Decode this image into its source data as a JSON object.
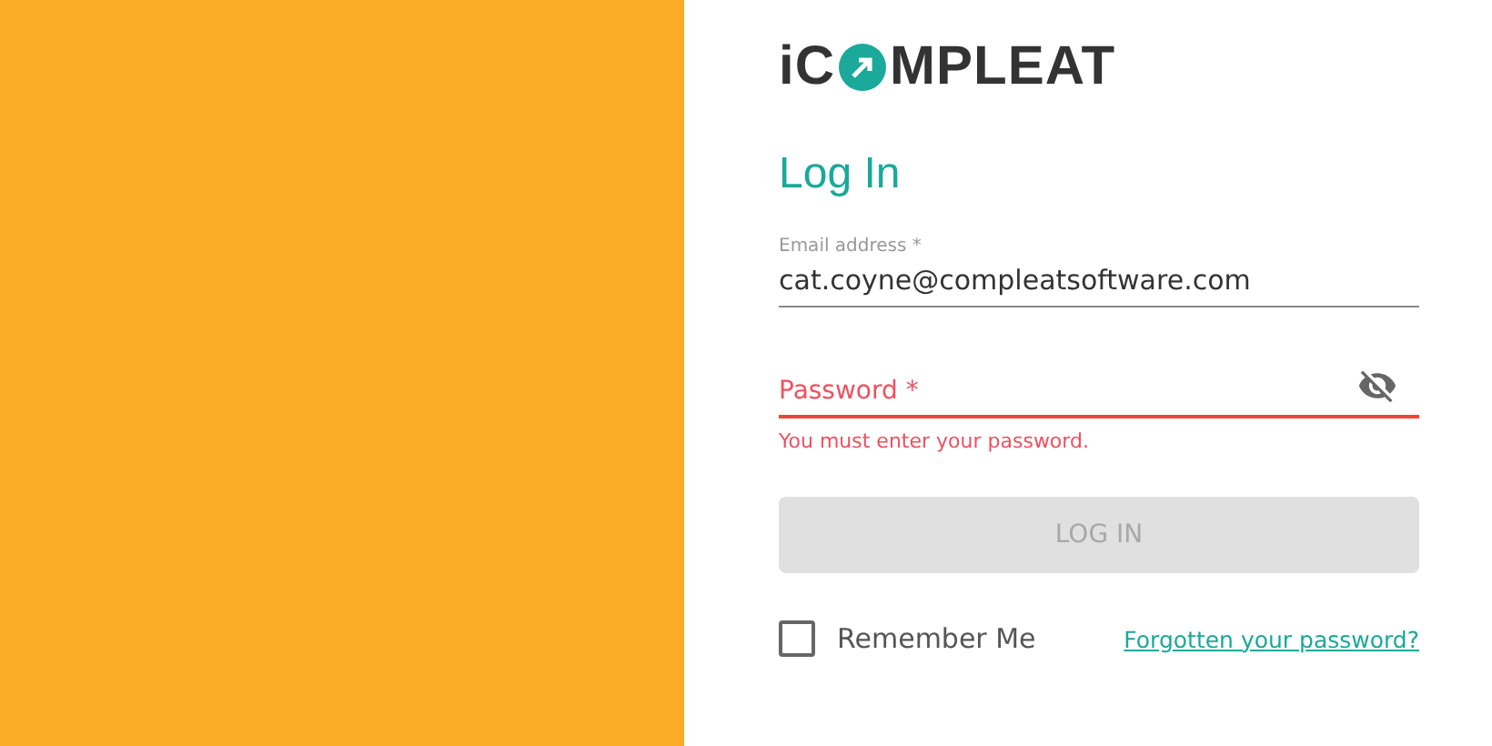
{
  "logo": {
    "text_before": "iC",
    "text_after": "MPLEAT"
  },
  "title": "Log In",
  "email": {
    "label": "Email address *",
    "value": "cat.coyne@compleatsoftware.com",
    "error": false
  },
  "password": {
    "placeholder": "Password *",
    "error": true,
    "error_text": "You must enter your password."
  },
  "login_button": {
    "label": "LOG IN",
    "disabled": true
  },
  "remember": {
    "label": "Remember Me",
    "checked": false
  },
  "forgot_link": "Forgotten your password?"
}
